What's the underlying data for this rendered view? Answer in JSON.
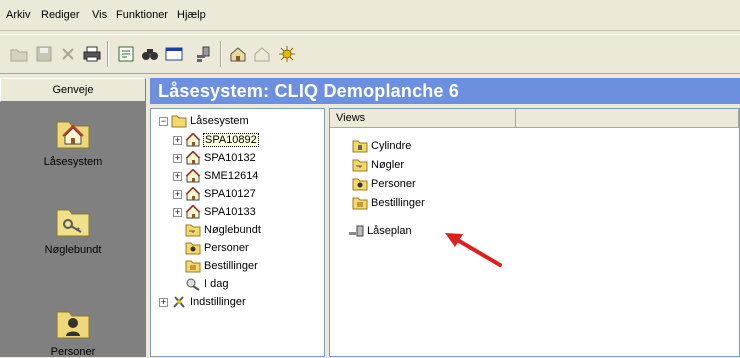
{
  "menu": [
    "Arkiv",
    "Rediger",
    "Vis",
    "Funktioner",
    "Hjælp"
  ],
  "toolbar_icons": [
    "open-folder-icon",
    "save-icon",
    "delete-icon",
    "print-icon",
    "properties-icon",
    "find-icon",
    "window-icon",
    "lock-key-icon",
    "house-icon",
    "house-outline-icon",
    "bug-icon"
  ],
  "genveje": {
    "header": "Genveje",
    "items": [
      {
        "label": "Låsesystem",
        "icon": "house-folder-icon"
      },
      {
        "label": "Nøglebundt",
        "icon": "key-folder-icon"
      },
      {
        "label": "Personer",
        "icon": "person-folder-icon"
      }
    ]
  },
  "title": "Låsesystem: CLIQ Demoplanche 6",
  "tree": {
    "root": "Låsesystem",
    "systems": [
      "SPA10892",
      "SPA10132",
      "SME12614",
      "SPA10127",
      "SPA10133"
    ],
    "nodes": [
      "Nøglebundt",
      "Personer",
      "Bestillinger",
      "I dag",
      "Indstillinger"
    ]
  },
  "views": {
    "header": "Views",
    "items": [
      "Cylindre",
      "Nøgler",
      "Personer",
      "Bestillinger",
      "Låseplan"
    ]
  },
  "colors": {
    "title_bar": "#6d8fe0",
    "annotation_arrow": "#e0201c",
    "side_panel": "#808080"
  }
}
